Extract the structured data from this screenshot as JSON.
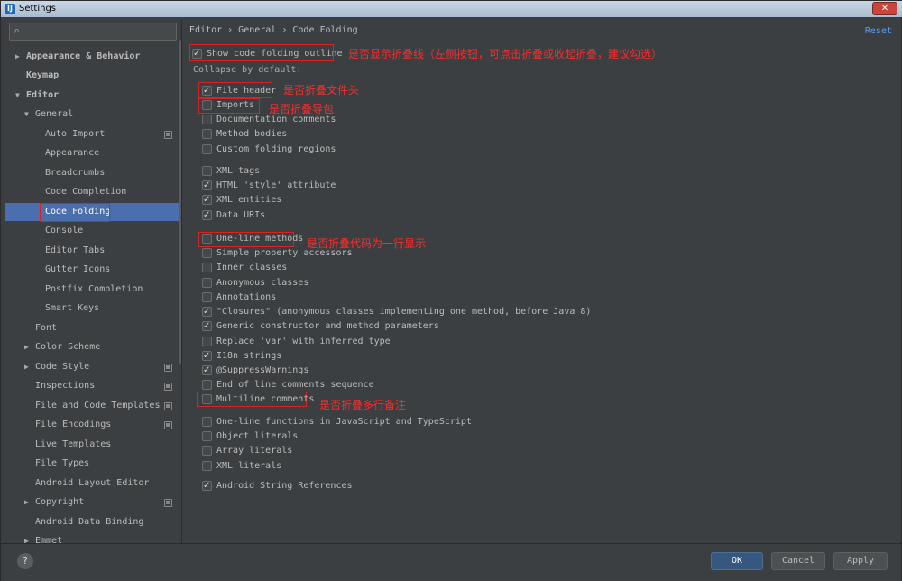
{
  "window": {
    "title": "Settings"
  },
  "search": {
    "placeholder": ""
  },
  "sidebar": {
    "items": [
      {
        "label": "Appearance & Behavior"
      },
      {
        "label": "Keymap"
      },
      {
        "label": "Editor"
      },
      {
        "label": "General"
      },
      {
        "label": "Auto Import"
      },
      {
        "label": "Appearance"
      },
      {
        "label": "Breadcrumbs"
      },
      {
        "label": "Code Completion"
      },
      {
        "label": "Code Folding"
      },
      {
        "label": "Console"
      },
      {
        "label": "Editor Tabs"
      },
      {
        "label": "Gutter Icons"
      },
      {
        "label": "Postfix Completion"
      },
      {
        "label": "Smart Keys"
      },
      {
        "label": "Font"
      },
      {
        "label": "Color Scheme"
      },
      {
        "label": "Code Style"
      },
      {
        "label": "Inspections"
      },
      {
        "label": "File and Code Templates"
      },
      {
        "label": "File Encodings"
      },
      {
        "label": "Live Templates"
      },
      {
        "label": "File Types"
      },
      {
        "label": "Android Layout Editor"
      },
      {
        "label": "Copyright"
      },
      {
        "label": "Android Data Binding"
      },
      {
        "label": "Emmet"
      }
    ]
  },
  "content": {
    "breadcrumb": "Editor › General › Code Folding",
    "reset_label": "Reset",
    "show_outline": "Show code folding outline",
    "collapse_label": "Collapse by default:",
    "options": [
      {
        "label": "File header",
        "checked": true
      },
      {
        "label": "Imports",
        "checked": false
      },
      {
        "label": "Documentation comments",
        "checked": false
      },
      {
        "label": "Method bodies",
        "checked": false
      },
      {
        "label": "Custom folding regions",
        "checked": false
      },
      {
        "label": "XML tags",
        "checked": false
      },
      {
        "label": "HTML 'style' attribute",
        "checked": true
      },
      {
        "label": "XML entities",
        "checked": true
      },
      {
        "label": "Data URIs",
        "checked": true
      },
      {
        "label": "One-line methods",
        "checked": false
      },
      {
        "label": "Simple property accessors",
        "checked": false
      },
      {
        "label": "Inner classes",
        "checked": false
      },
      {
        "label": "Anonymous classes",
        "checked": false
      },
      {
        "label": "Annotations",
        "checked": false
      },
      {
        "label": "\"Closures\" (anonymous classes implementing one method, before Java 8)",
        "checked": true
      },
      {
        "label": "Generic constructor and method parameters",
        "checked": true
      },
      {
        "label": "Replace 'var' with inferred type",
        "checked": false
      },
      {
        "label": "I18n strings",
        "checked": true
      },
      {
        "label": "@SuppressWarnings",
        "checked": true
      },
      {
        "label": "End of line comments sequence",
        "checked": false
      },
      {
        "label": "Multiline comments",
        "checked": false
      },
      {
        "label": "One-line functions in JavaScript and TypeScript",
        "checked": false
      },
      {
        "label": "Object literals",
        "checked": false
      },
      {
        "label": "Array literals",
        "checked": false
      },
      {
        "label": "XML literals",
        "checked": false
      },
      {
        "label": "Android String References",
        "checked": true
      }
    ]
  },
  "annotations": {
    "outline": "是否显示折叠线（左侧按钮，可点击折叠或收起折叠，建议勾选）",
    "file_header": "是否折叠文件头",
    "imports": "是否折叠导包",
    "one_line": "是否折叠代码为一行显示",
    "multiline": "是否折叠多行备注"
  },
  "footer": {
    "help_label": "?",
    "ok_label": "OK",
    "cancel_label": "Cancel",
    "apply_label": "Apply"
  }
}
